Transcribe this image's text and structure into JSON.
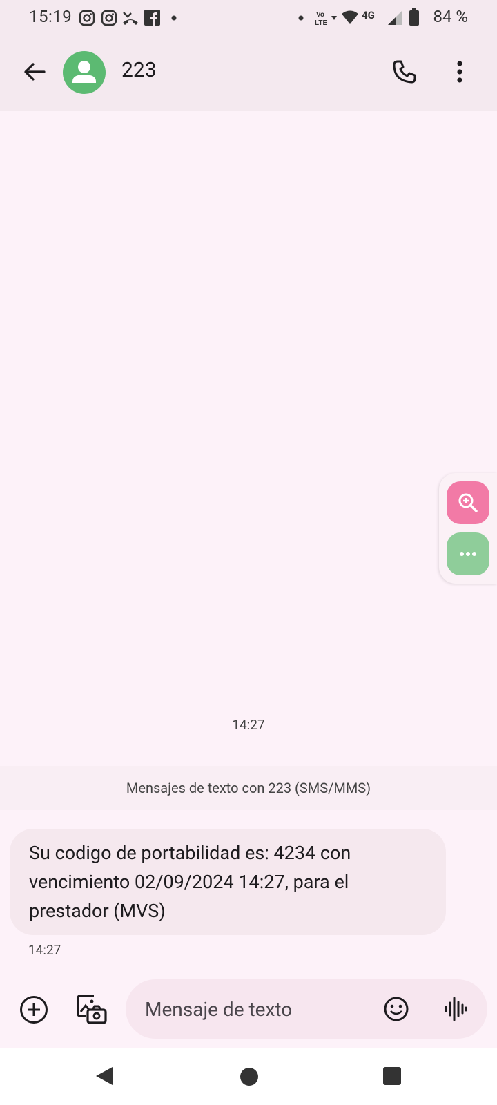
{
  "status_bar": {
    "time": "15:19",
    "battery_percent": "84 %",
    "network": "4G",
    "left_icons": [
      "instagram-icon",
      "instagram-icon",
      "missed-call-icon",
      "facebook-icon",
      "dot-icon"
    ],
    "right_icons": [
      "dot-icon",
      "volte-icon",
      "wifi-icon",
      "signal-icon",
      "battery-icon"
    ]
  },
  "header": {
    "contact_name": "223",
    "avatar_color": "#5cba72"
  },
  "conversation": {
    "top_timestamp": "14:27",
    "thread_label": "Mensajes de texto con 223 (SMS/MMS)",
    "messages": [
      {
        "text": "Su codigo de portabilidad es: 4234 con vencimiento 02/09/2024 14:27, para el prestador (MVS)",
        "time": "14:27"
      }
    ]
  },
  "composer": {
    "placeholder": "Mensaje de texto"
  },
  "colors": {
    "background": "#fdf2f9",
    "appbar": "#f4e9ef",
    "zoom_fab": "#f27aa6",
    "more_fab": "#8fcd9a"
  }
}
